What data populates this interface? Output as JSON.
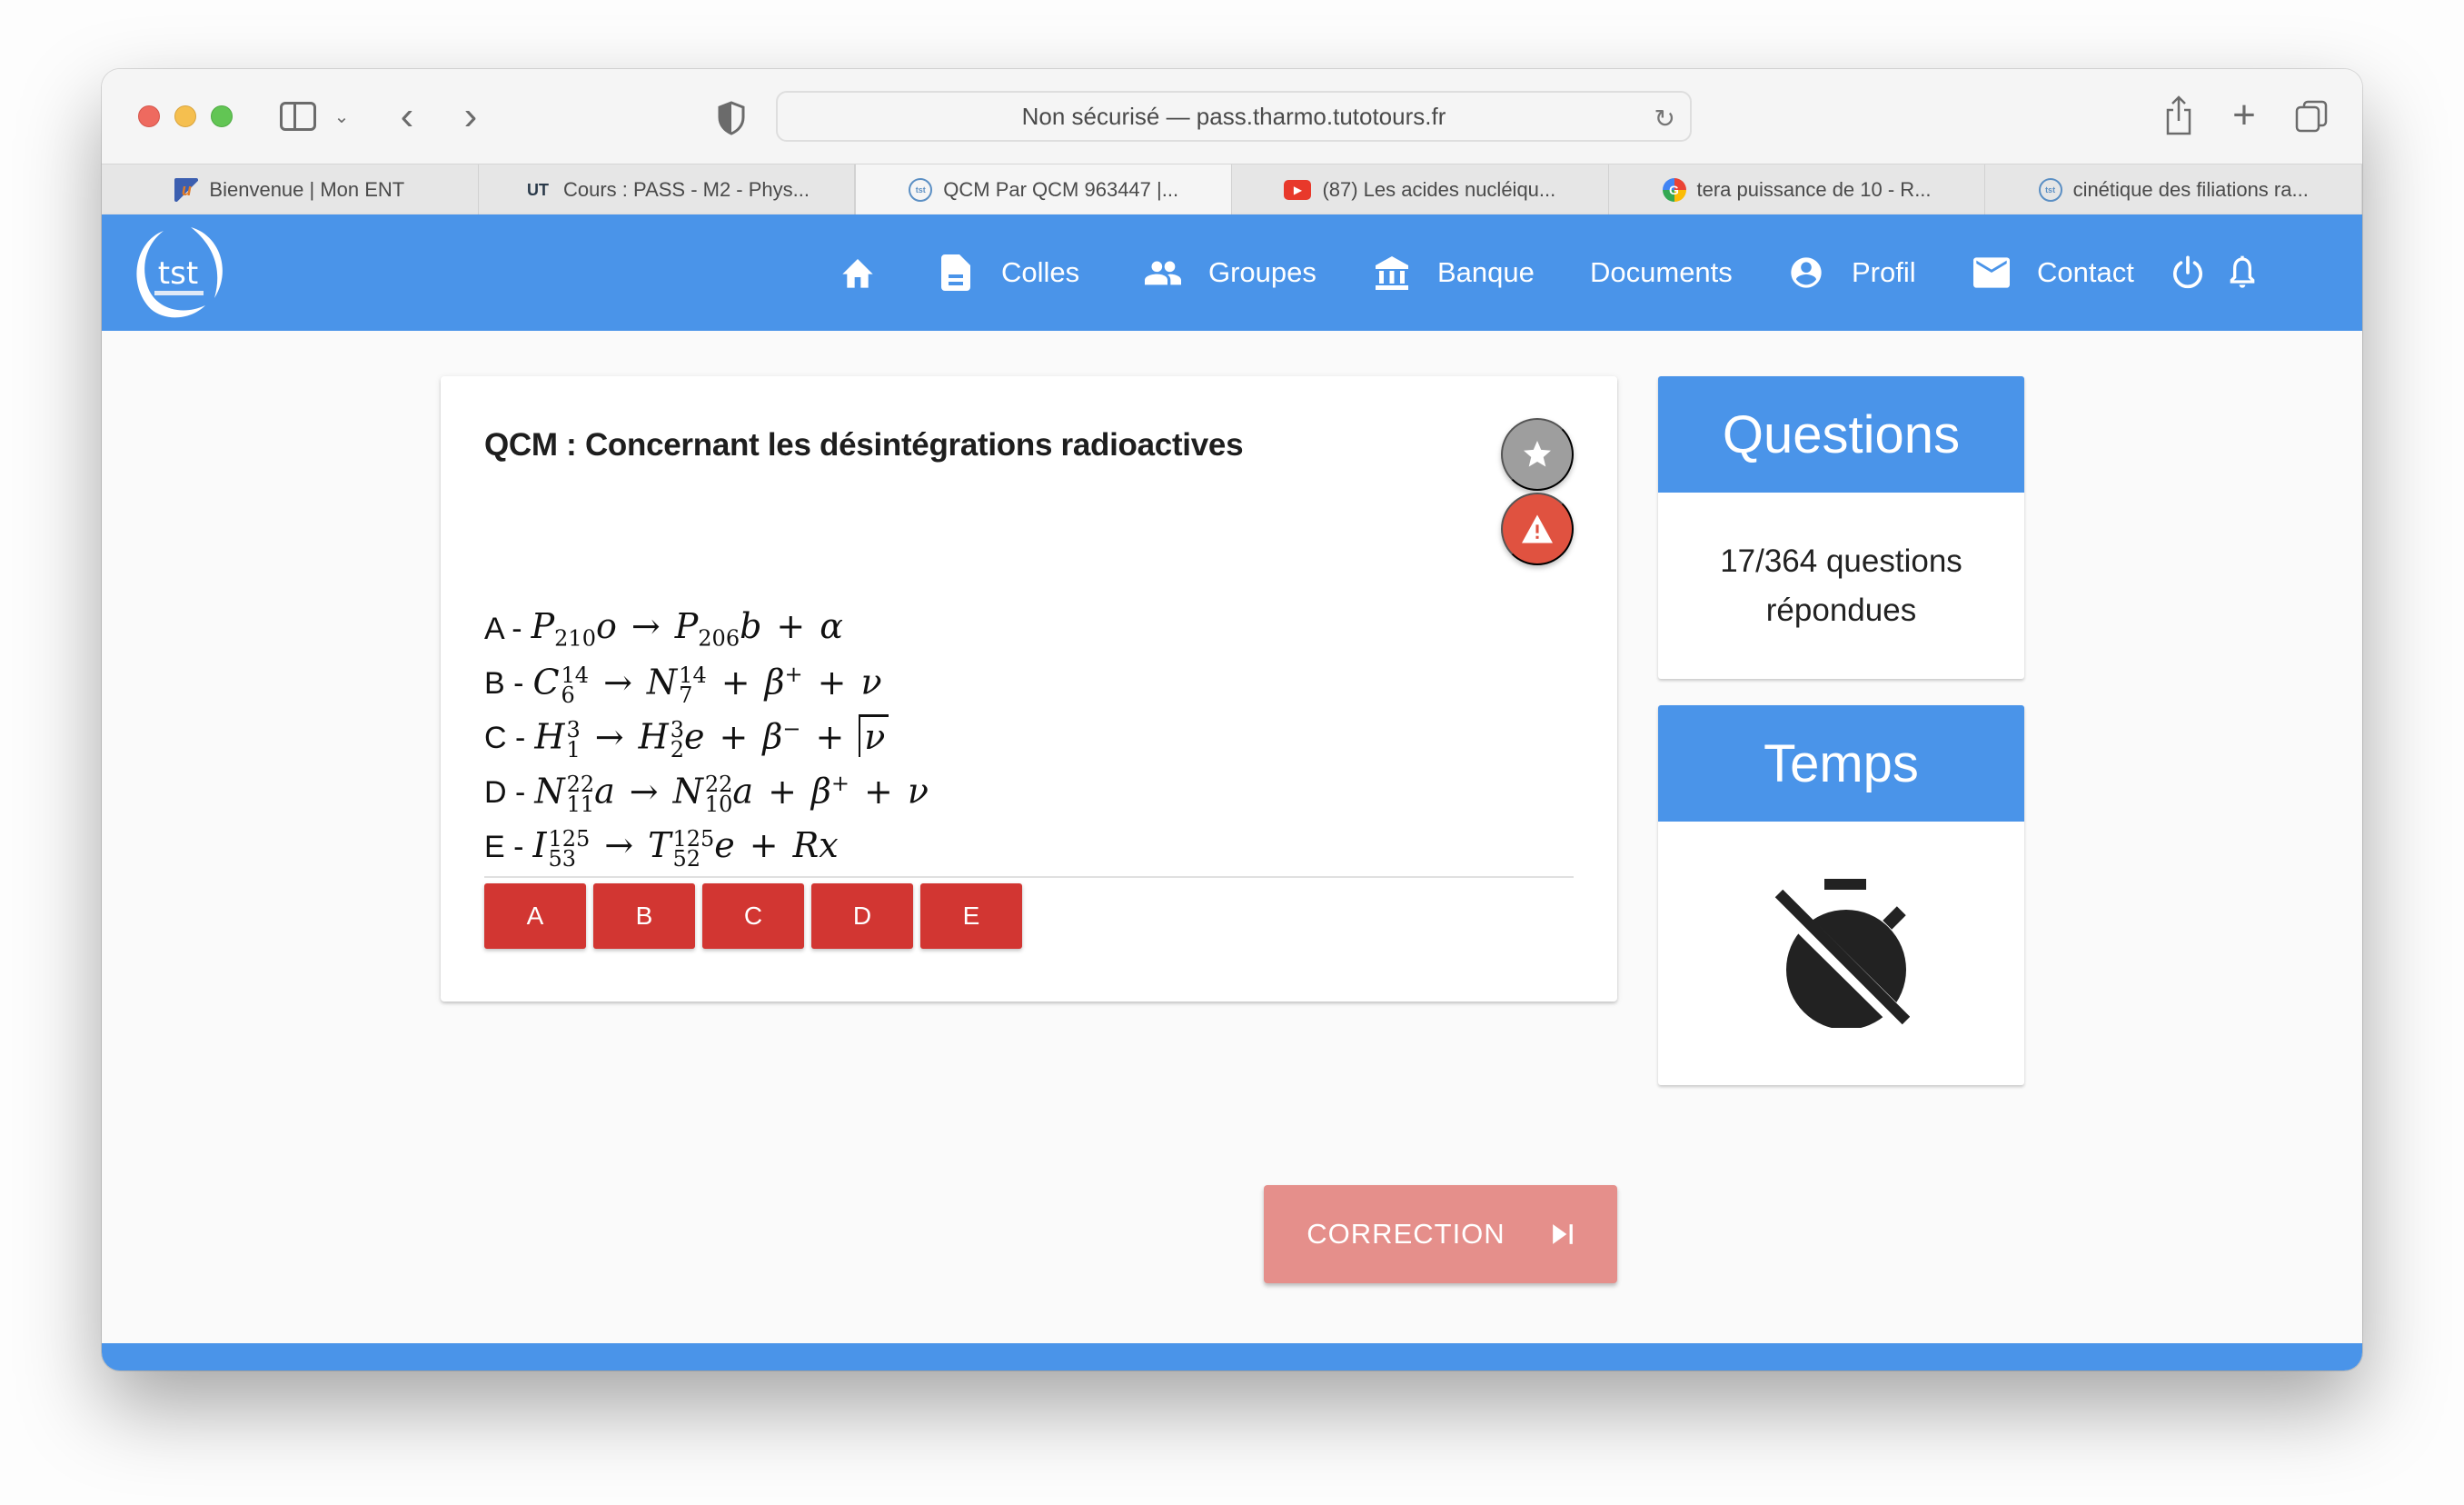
{
  "browser": {
    "url_text": "Non sécurisé — pass.tharmo.tutotours.fr",
    "tabs": [
      {
        "label": "Bienvenue | Mon ENT",
        "favicon": "ent-u-icon",
        "active": false
      },
      {
        "label": "Cours : PASS - M2 - Phys...",
        "favicon": "ut-icon",
        "active": false
      },
      {
        "label": "QCM Par QCM 963447 |...",
        "favicon": "tst-icon",
        "active": true
      },
      {
        "label": "(87) Les acides nucléiqu...",
        "favicon": "youtube-icon",
        "active": false
      },
      {
        "label": "tera puissance de 10 - R...",
        "favicon": "google-icon",
        "active": false
      },
      {
        "label": "cinétique des filiations ra...",
        "favicon": "tst-icon",
        "active": false
      }
    ]
  },
  "navbar": {
    "logo": "tst-logo",
    "items": [
      {
        "label": "",
        "icon": "home-icon"
      },
      {
        "label": "Colles",
        "icon": "document-icon"
      },
      {
        "label": "Groupes",
        "icon": "groups-icon"
      },
      {
        "label": "Banque",
        "icon": "bank-icon"
      },
      {
        "label": "Documents",
        "icon": ""
      },
      {
        "label": "Profil",
        "icon": "account-circle-icon"
      },
      {
        "label": "Contact",
        "icon": "mail-icon"
      },
      {
        "label": "",
        "icon": "power-icon"
      },
      {
        "label": "",
        "icon": "bell-icon"
      }
    ],
    "colors": {
      "primary": "#4a94e9"
    }
  },
  "question": {
    "title": "QCM : Concernant les désintégrations radioactives",
    "propositions": [
      {
        "letter": "A -",
        "formula": "P_{210}o → P_{206}b + α"
      },
      {
        "letter": "B -",
        "formula": "C^{14}_{6} → N^{14}_{7} + β^{+} + ν"
      },
      {
        "letter": "C -",
        "formula": "H^{3}_{1} → H^{3}_{2}e + β^{-} + \\overline{)ν}"
      },
      {
        "letter": "D -",
        "formula": "N^{22}_{11}a → N^{22}_{10}a + β^{+} + ν"
      },
      {
        "letter": "E -",
        "formula": "I^{125}_{53} → T^{125}_{52}e + Rx"
      }
    ],
    "answers": [
      "A",
      "B",
      "C",
      "D",
      "E"
    ],
    "answer_color": "#d23632"
  },
  "correction": {
    "label": "CORRECTION",
    "icon": "skip-next-icon",
    "color": "#e58f8b"
  },
  "panels": {
    "questions": {
      "title": "Questions",
      "body": "17/364 questions répondues",
      "answered": 17,
      "total": 364
    },
    "time": {
      "title": "Temps",
      "icon": "timer-off-icon"
    }
  }
}
